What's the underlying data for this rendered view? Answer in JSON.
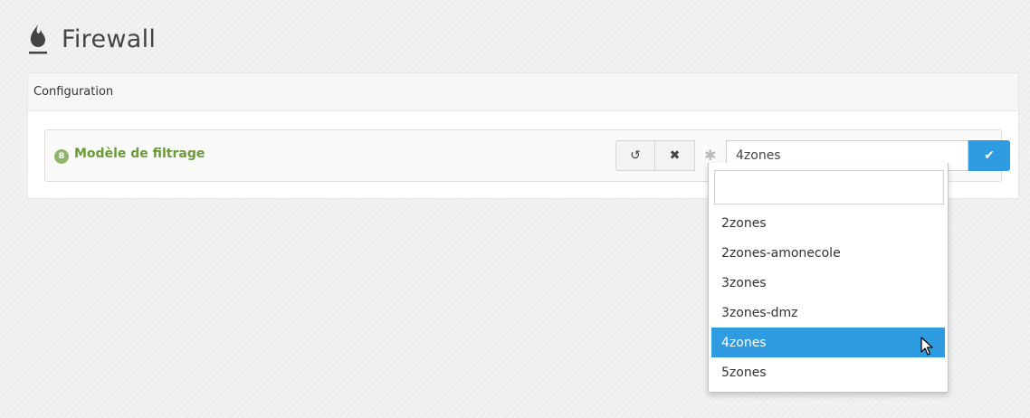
{
  "header": {
    "title": "Firewall",
    "icon": "flame-icon"
  },
  "panel": {
    "heading": "Configuration",
    "row": {
      "badge": "B",
      "label": "Modèle de filtrage",
      "buttons": {
        "undo": "↺",
        "reset": "✖"
      },
      "default_marker": "✱",
      "select_value": "4zones",
      "confirm": "✔"
    }
  },
  "dropdown": {
    "search_value": "",
    "options": [
      {
        "label": "2zones",
        "selected": false
      },
      {
        "label": "2zones-amonecole",
        "selected": false
      },
      {
        "label": "3zones",
        "selected": false
      },
      {
        "label": "3zones-dmz",
        "selected": false
      },
      {
        "label": "4zones",
        "selected": true
      },
      {
        "label": "5zones",
        "selected": false
      }
    ]
  },
  "colors": {
    "accent_blue": "#2f9be0",
    "label_green": "#6a9a35",
    "badge_green": "#8fb56a"
  }
}
